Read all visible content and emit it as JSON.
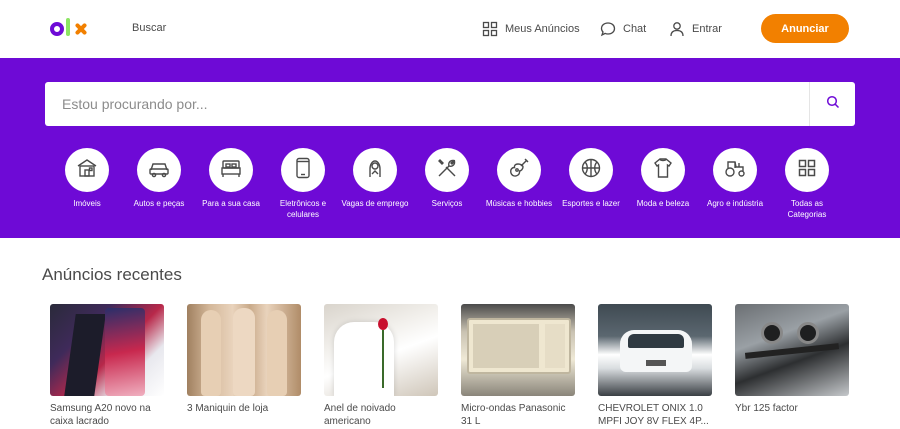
{
  "header": {
    "logo_text": "olx",
    "search_link": "Buscar",
    "my_ads": "Meus Anúncios",
    "chat": "Chat",
    "login": "Entrar",
    "cta": "Anunciar"
  },
  "search": {
    "placeholder": "Estou procurando por...",
    "icon": "search-icon"
  },
  "categories": [
    {
      "label": "Imóveis",
      "icon": "house-icon"
    },
    {
      "label": "Autos e peças",
      "icon": "car-icon"
    },
    {
      "label": "Para a sua casa",
      "icon": "bed-icon"
    },
    {
      "label": "Eletrônicos e celulares",
      "icon": "phone-icon"
    },
    {
      "label": "Vagas de emprego",
      "icon": "person-icon"
    },
    {
      "label": "Serviços",
      "icon": "tools-icon"
    },
    {
      "label": "Músicas e hobbies",
      "icon": "guitar-icon"
    },
    {
      "label": "Esportes e lazer",
      "icon": "ball-icon"
    },
    {
      "label": "Moda e beleza",
      "icon": "shirt-icon"
    },
    {
      "label": "Agro e indústria",
      "icon": "tractor-icon"
    },
    {
      "label": "Todas as Categorias",
      "icon": "grid-icon"
    }
  ],
  "recent": {
    "title": "Anúncios recentes",
    "items": [
      {
        "title": "Samsung A20 novo na caixa lacrado"
      },
      {
        "title": "3 Maniquin de loja"
      },
      {
        "title": "Anel de noivado americano"
      },
      {
        "title": "Micro-ondas Panasonic 31 L"
      },
      {
        "title": "CHEVROLET ONIX 1.0 MPFI JOY 8V FLEX 4P..."
      },
      {
        "title": "Ybr 125 factor"
      }
    ]
  },
  "colors": {
    "brand_purple": "#6e0ad6",
    "cta_orange": "#f28000",
    "logo_green": "#8ce563"
  }
}
